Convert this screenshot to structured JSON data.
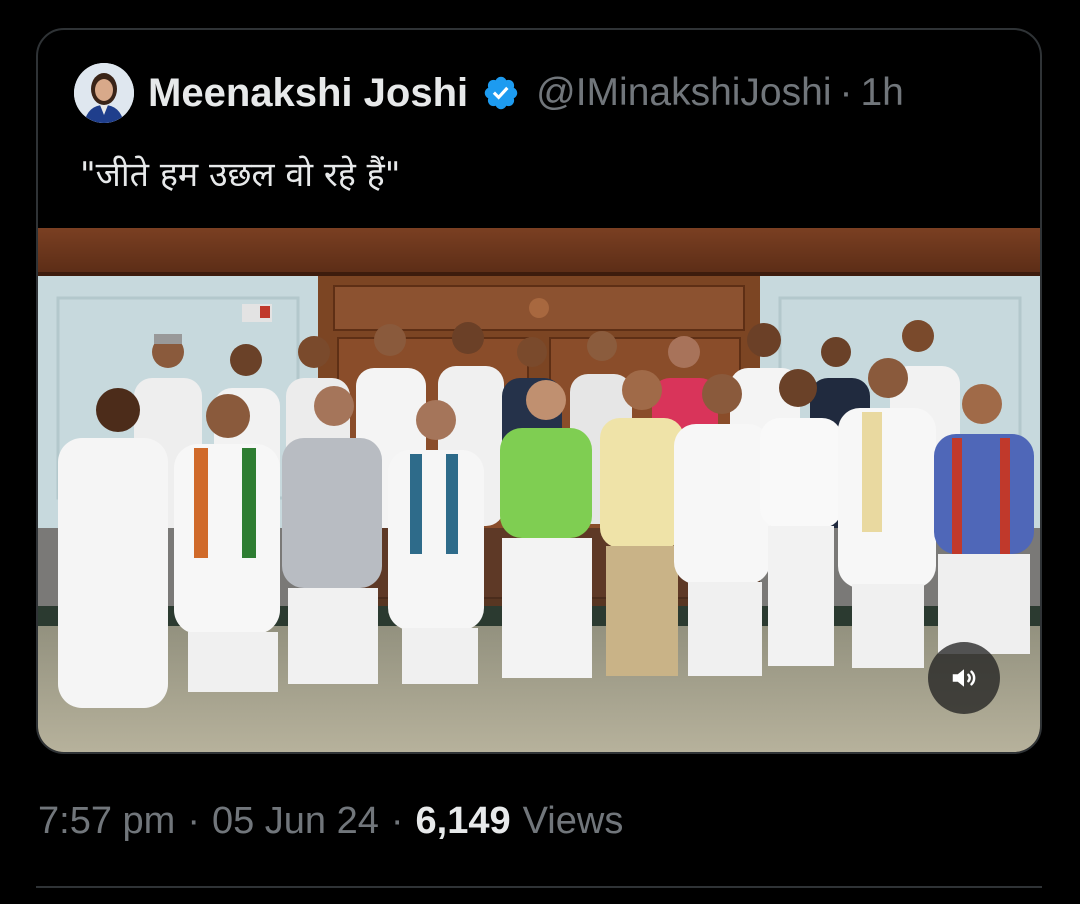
{
  "quoted_tweet": {
    "author_name": "Meenakshi Joshi",
    "handle": "@IMinakshiJoshi",
    "separator": "·",
    "relative_time": "1h",
    "verified": true,
    "text": "\"जीते हम उछल वो रहे हैं\"",
    "media": {
      "type": "photo",
      "mute_icon": "speaker-icon"
    }
  },
  "tweet_meta": {
    "time": "7:57 pm",
    "date": "05 Jun 24",
    "separator": "·",
    "views_count": "6,149",
    "views_label": "Views"
  },
  "colors": {
    "background": "#000000",
    "primary_text": "#e7e9ea",
    "secondary_text": "#71767b",
    "border": "#2f3336",
    "verified_blue": "#1d9bf0"
  }
}
